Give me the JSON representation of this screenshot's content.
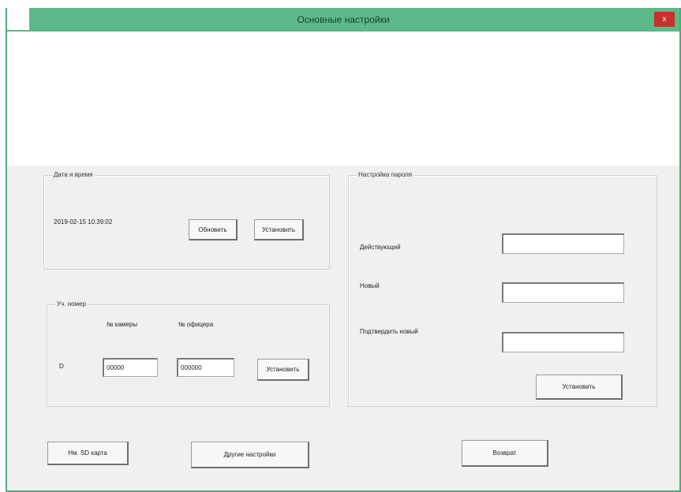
{
  "window": {
    "title": "Основные настройки",
    "close_label": "x"
  },
  "datetime": {
    "group_title": "Дата и время",
    "value": "2019-02-15 10:39:02",
    "refresh_label": "Обновить",
    "set_label": "Установить"
  },
  "device_number": {
    "group_title": "Уч. номер",
    "camera_header": "№ камеры",
    "officer_header": "№ офицера",
    "prefix": "D",
    "camera_value": "00000",
    "officer_value": "000000",
    "set_label": "Установить"
  },
  "password": {
    "group_title": "Настройка пароля",
    "current_label": "Действующий",
    "new_label": "Новый",
    "confirm_label": "Подтвердить новый",
    "current_value": "",
    "new_value": "",
    "confirm_value": "",
    "set_label": "Установить"
  },
  "footer": {
    "sd_card_label": "Нм. SD карта",
    "other_settings_label": "Другие настройки",
    "back_label": "Возврат"
  },
  "colors": {
    "titlebar": "#5bb98a",
    "frame": "#4faa7c",
    "close": "#c9302c",
    "panel": "#f0f0f0"
  }
}
